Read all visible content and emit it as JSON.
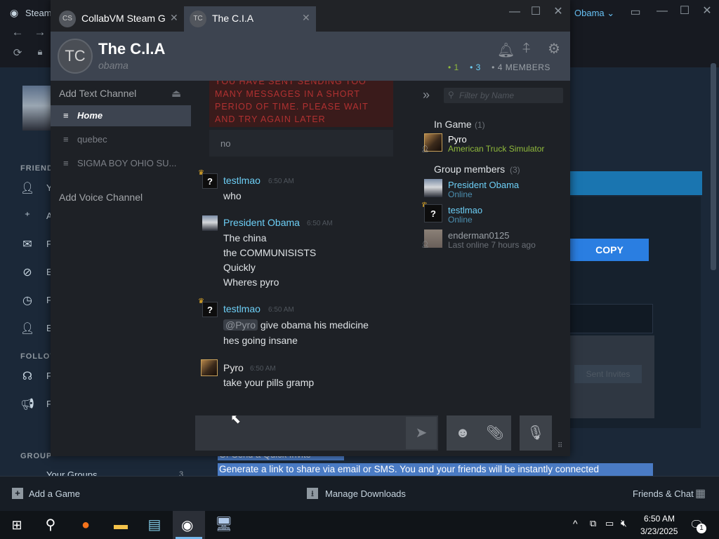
{
  "steam": {
    "app_title": "Steam",
    "user_menu_label": "Obama",
    "sidebar_heading_friends": "FRIEND",
    "sidebar_heading_follow": "FOLLOV",
    "sidebar_heading_groups": "GROUP",
    "sidebar_items": [
      {
        "icon": "person-icon",
        "label": "Y"
      },
      {
        "icon": "add-friend-icon",
        "label": "A"
      },
      {
        "icon": "mail-icon",
        "label": "F"
      },
      {
        "icon": "block-icon",
        "label": "E"
      },
      {
        "icon": "clock-icon",
        "label": "F"
      },
      {
        "icon": "person-icon",
        "label": "E"
      },
      {
        "icon": "follow-icon",
        "label": "F"
      },
      {
        "icon": "megaphone-icon",
        "label": "F"
      }
    ],
    "your_groups_label": "Your Groups",
    "your_groups_count": "3",
    "copy_button": "COPY",
    "box_button": "Sent Invites",
    "selected_heading": "Or Send a Quick Invite",
    "selected_text": "Generate a link to share via email or SMS. You and your friends will be instantly connected",
    "bottom_add_game": "Add a Game",
    "bottom_manage_downloads": "Manage Downloads",
    "bottom_friends_chat": "Friends & Chat"
  },
  "chat": {
    "tabs": [
      {
        "avatar": "CS",
        "title": "CollabVM Steam G"
      },
      {
        "avatar": "TC",
        "title": "The C.I.A"
      }
    ],
    "group": {
      "avatar": "TC",
      "name": "The C.I.A",
      "subtitle": "obama",
      "count_ingame": "1",
      "count_online": "3",
      "count_members": "4 MEMBERS"
    },
    "channels": {
      "add_text": "Add Text Channel",
      "text_channels": [
        "Home",
        "quebec",
        "SIGMA BOY OHIO SU..."
      ],
      "add_voice": "Add Voice Channel"
    },
    "system_bubble": "YOU HAVE SENT SENDING TOO MANY MESSAGES IN A SHORT PERIOD OF TIME. PLEASE WAIT AND TRY AGAIN LATER",
    "no_bubble": "no",
    "messages": [
      {
        "author": "testlmao",
        "time": "6:50 AM",
        "lines": [
          "who"
        ]
      },
      {
        "author": "President Obama",
        "time": "6:50 AM",
        "lines": [
          "The china",
          "the COMMUNISISTS",
          "Quickly",
          "Wheres pyro"
        ]
      },
      {
        "author": "testlmao",
        "time": "6:50 AM",
        "mention": "@Pyro",
        "lines": [
          "give obama his medicine",
          "hes going insane"
        ]
      },
      {
        "author": "Pyro",
        "time": "6:50 AM",
        "lines": [
          "take your pills gramp"
        ]
      }
    ],
    "members": {
      "filter_placeholder": "Filter by Name",
      "ingame_heading": "In Game",
      "ingame_count": "(1)",
      "group_heading": "Group members",
      "group_count": "(3)",
      "list": [
        {
          "name": "Pyro",
          "status": "American Truck Simulator"
        },
        {
          "name": "President Obama",
          "status": "Online"
        },
        {
          "name": "testlmao",
          "status": "Online"
        },
        {
          "name": "enderman0125",
          "status": "Last online 7 hours ago"
        }
      ]
    }
  },
  "taskbar": {
    "time": "6:50 AM",
    "date": "3/23/2025",
    "notification_count": "1"
  },
  "colors": {
    "ingame_green": "#90ba3c",
    "online_blue": "#6dcff6",
    "error_red": "#b13131",
    "offline_gray": "#7b7f86"
  }
}
